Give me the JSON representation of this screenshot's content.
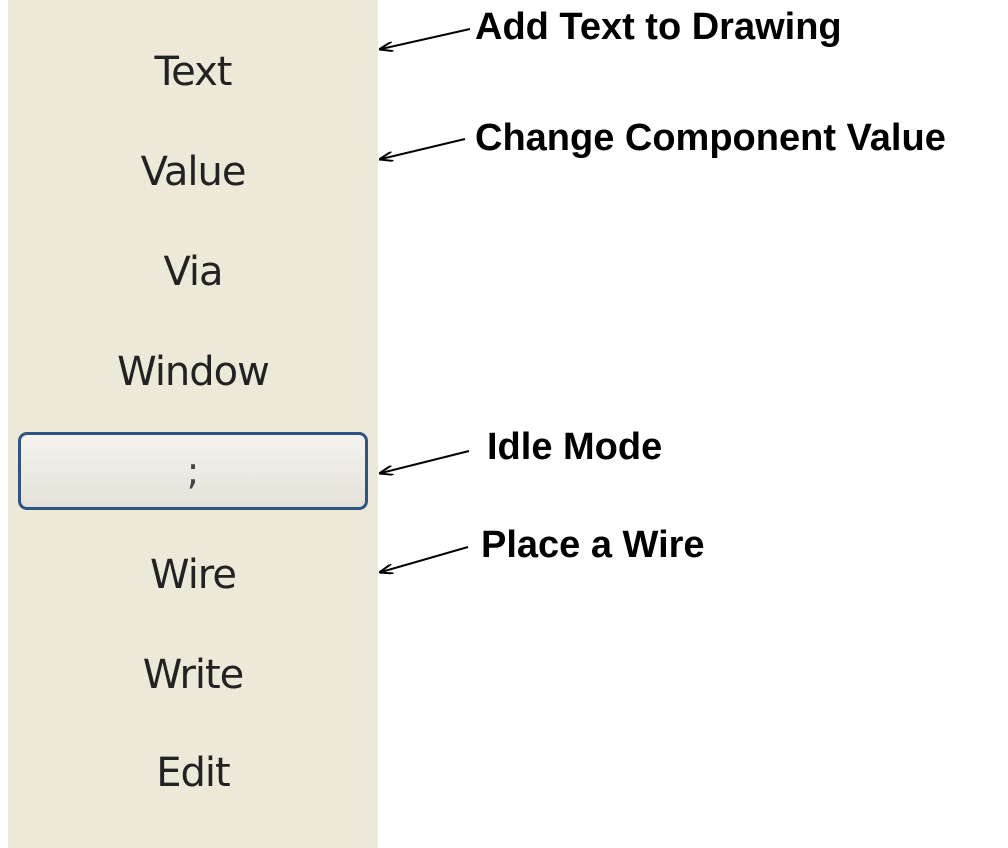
{
  "menu": {
    "items": [
      {
        "label": "Text"
      },
      {
        "label": "Value"
      },
      {
        "label": "Via"
      },
      {
        "label": "Window"
      },
      {
        "label": ";"
      },
      {
        "label": "Wire"
      },
      {
        "label": "Write"
      },
      {
        "label": "Edit"
      }
    ]
  },
  "callouts": {
    "text": "Add Text to Drawing",
    "value": "Change Component Value",
    "idle": "Idle Mode",
    "wire": "Place a Wire"
  },
  "colors": {
    "panel_background": "#ece9d8",
    "button_border": "#2c5583",
    "callout_text": "#000000"
  }
}
